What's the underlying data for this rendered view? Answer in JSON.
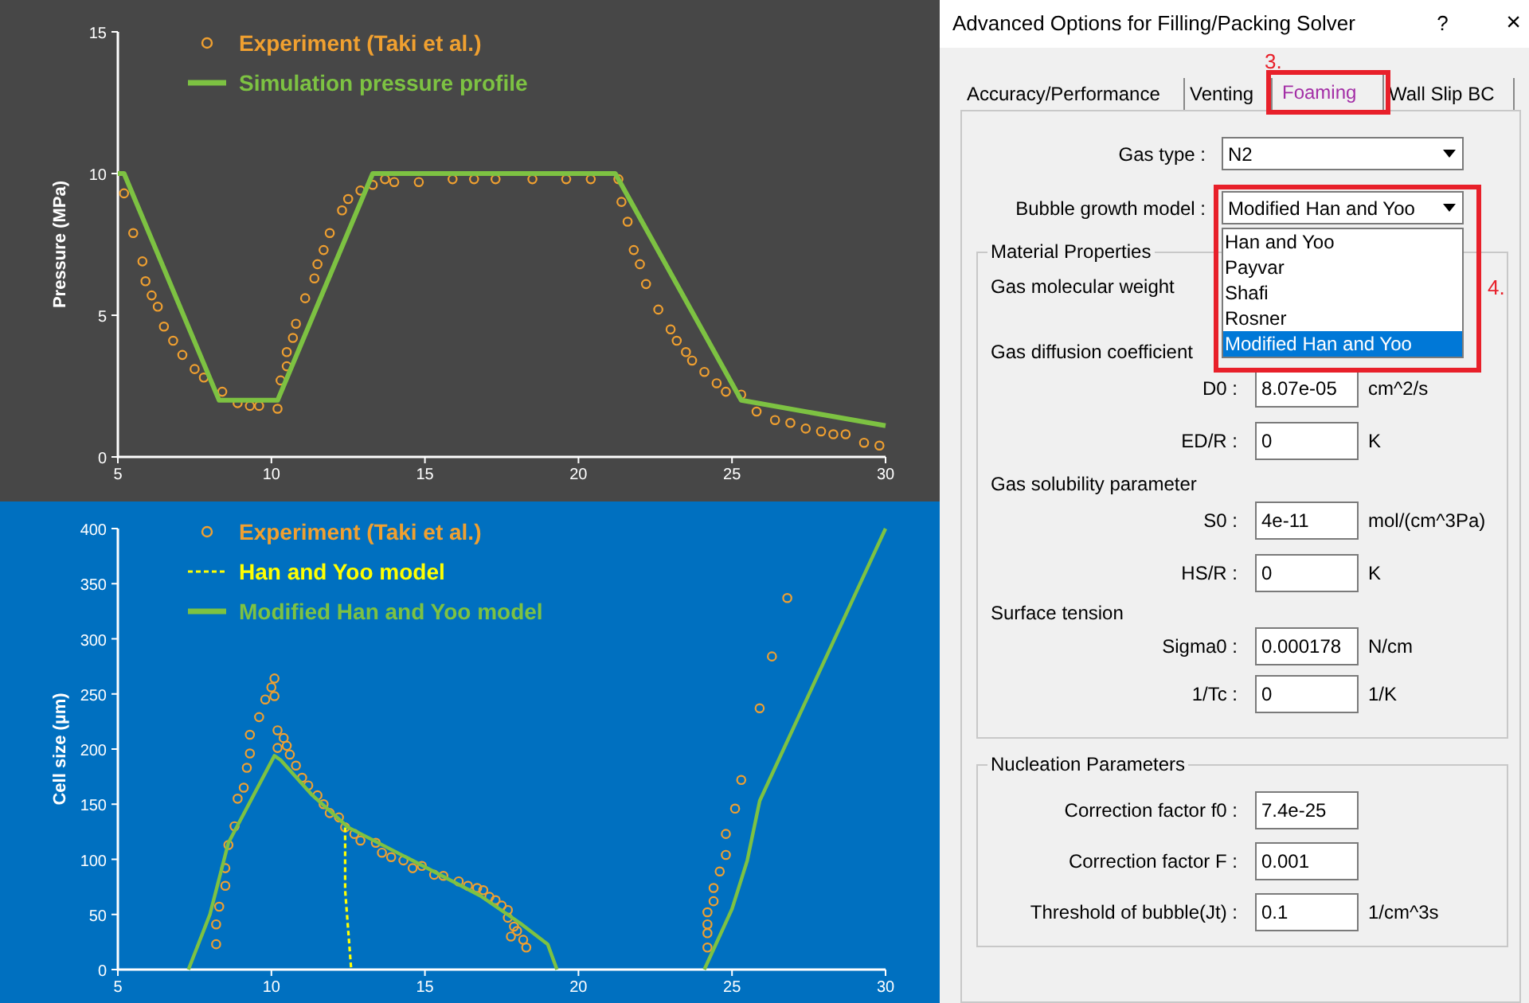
{
  "pressure_chart": {
    "chart_data": {
      "type": "scatter",
      "legend": true,
      "ylabel": "Pressure (MPa)",
      "xlim": [
        5,
        30
      ],
      "ylim": [
        0,
        15
      ],
      "xticks": [
        5,
        10,
        15,
        20,
        25,
        30
      ],
      "yticks": [
        0,
        5,
        10,
        15
      ],
      "series": [
        {
          "name": "Experiment (Taki et al.)",
          "type": "scatter",
          "color": "#f0a030",
          "x": [
            5.2,
            5.5,
            5.8,
            5.9,
            6.1,
            6.3,
            6.5,
            6.8,
            7.1,
            7.5,
            7.8,
            8.4,
            8.9,
            9.3,
            9.6,
            10.2,
            10.3,
            10.5,
            10.5,
            10.7,
            10.8,
            11.1,
            11.4,
            11.5,
            11.7,
            11.9,
            12.3,
            12.5,
            12.9,
            13.3,
            13.7,
            14.0,
            14.8,
            15.9,
            16.6,
            17.3,
            18.5,
            19.6,
            20.4,
            21.3,
            21.4,
            21.6,
            21.8,
            22.0,
            22.2,
            22.6,
            23.0,
            23.2,
            23.5,
            23.7,
            24.1,
            24.5,
            24.8,
            25.3,
            25.8,
            26.4,
            26.9,
            27.4,
            27.9,
            28.3,
            28.7,
            29.3,
            29.8
          ],
          "values": [
            9.3,
            7.9,
            6.9,
            6.2,
            5.7,
            5.3,
            4.6,
            4.1,
            3.6,
            3.1,
            2.8,
            2.3,
            1.9,
            1.8,
            1.8,
            1.7,
            2.7,
            3.2,
            3.7,
            4.2,
            4.7,
            5.6,
            6.3,
            6.8,
            7.3,
            7.9,
            8.7,
            9.1,
            9.4,
            9.6,
            9.8,
            9.7,
            9.7,
            9.8,
            9.8,
            9.8,
            9.8,
            9.8,
            9.8,
            9.8,
            9.0,
            8.3,
            7.3,
            6.8,
            6.1,
            5.2,
            4.5,
            4.1,
            3.7,
            3.4,
            3.0,
            2.6,
            2.3,
            2.2,
            1.6,
            1.3,
            1.2,
            1.0,
            0.9,
            0.8,
            0.8,
            0.5,
            0.4
          ]
        },
        {
          "name": "Simulation pressure profile",
          "type": "line",
          "color": "#7dc242",
          "x": [
            5.0,
            5.2,
            8.3,
            10.2,
            13.3,
            21.2,
            25.3,
            30.0
          ],
          "values": [
            10.0,
            10.0,
            2.0,
            2.0,
            10.0,
            10.0,
            2.0,
            1.1
          ]
        }
      ]
    }
  },
  "cell_size_chart": {
    "chart_data": {
      "type": "scatter",
      "legend": true,
      "ylabel": "Cell size (µm)",
      "xlim": [
        5,
        30
      ],
      "ylim": [
        0,
        400
      ],
      "xticks": [
        5,
        10,
        15,
        20,
        25,
        30
      ],
      "yticks": [
        0,
        50,
        100,
        150,
        200,
        250,
        300,
        350,
        400
      ],
      "series": [
        {
          "name": "Experiment (Taki et al.)",
          "type": "scatter",
          "color": "#f0a030",
          "x": [
            8.2,
            8.2,
            8.3,
            8.5,
            8.5,
            8.6,
            8.8,
            8.9,
            9.1,
            9.2,
            9.3,
            9.3,
            9.6,
            9.8,
            10.0,
            10.1,
            10.1,
            10.2,
            10.2,
            10.4,
            10.5,
            10.6,
            10.8,
            11.0,
            11.2,
            11.5,
            11.7,
            11.9,
            12.2,
            12.4,
            12.7,
            12.9,
            13.4,
            13.6,
            13.9,
            14.3,
            14.6,
            14.9,
            15.3,
            15.6,
            16.1,
            16.4,
            16.7,
            16.9,
            17.1,
            17.3,
            17.5,
            17.7,
            17.7,
            17.9,
            17.8,
            18.0,
            18.2,
            18.3,
            24.2,
            24.2,
            24.2,
            24.2,
            24.4,
            24.4,
            24.6,
            24.8,
            24.8,
            25.1,
            25.3,
            25.9,
            26.3,
            26.8
          ],
          "values": [
            23,
            41,
            57,
            76,
            92,
            113,
            130,
            155,
            165,
            183,
            196,
            213,
            229,
            245,
            256,
            264,
            248,
            217,
            201,
            210,
            203,
            195,
            185,
            174,
            167,
            158,
            150,
            142,
            138,
            129,
            123,
            117,
            115,
            106,
            102,
            99,
            92,
            94,
            86,
            85,
            80,
            76,
            74,
            72,
            66,
            63,
            58,
            54,
            47,
            39,
            30,
            35,
            27,
            20,
            20,
            33,
            41,
            52,
            62,
            74,
            89,
            104,
            123,
            146,
            172,
            237,
            284,
            337
          ]
        },
        {
          "name": "Han and Yoo model",
          "type": "line",
          "line_style": "dashed",
          "color": "#ffff00",
          "x": [
            12.4,
            12.4,
            12.6
          ],
          "values": [
            129,
            72,
            0
          ]
        },
        {
          "name": "Modified Han and Yoo model",
          "type": "line",
          "color": "#7dc242",
          "x": [
            7.3,
            8.0,
            8.6,
            10.1,
            10.3,
            11.3,
            12.5,
            14.8,
            16.8,
            18.1,
            19.0,
            19.3,
            null,
            24.1,
            25.0,
            25.5,
            25.9,
            30.0
          ],
          "values": [
            0,
            50,
            115,
            194,
            190,
            159,
            129,
            96,
            67,
            42,
            23,
            0,
            null,
            0,
            55,
            99,
            153,
            400
          ]
        }
      ]
    }
  },
  "dialog": {
    "title": "Advanced Options for Filling/Packing Solver",
    "help_button": "?",
    "close_button": "×",
    "tabs": [
      {
        "label": "Accuracy/Performance",
        "selected": false
      },
      {
        "label": "Venting",
        "selected": false
      },
      {
        "label": "Foaming",
        "selected": true
      },
      {
        "label": "Wall Slip BC",
        "selected": false
      }
    ],
    "gas_type": {
      "label": "Gas type :",
      "value": "N2"
    },
    "bubble_growth_model": {
      "label": "Bubble growth model :",
      "value": "Modified Han and Yoo",
      "expanded": true,
      "options": [
        {
          "label": "Han and Yoo",
          "selected": false
        },
        {
          "label": "Payvar",
          "selected": false
        },
        {
          "label": "Shafi",
          "selected": false
        },
        {
          "label": "Rosner",
          "selected": false
        },
        {
          "label": "Modified Han and Yoo",
          "selected": true
        }
      ]
    },
    "material_properties": {
      "title": "Material Properties",
      "sections": [
        {
          "heading": "Gas molecular weight"
        },
        {
          "heading": "Gas diffusion coefficient",
          "fields": [
            {
              "label": "D0 :",
              "value": "8.07e-05",
              "unit": "cm^2/s"
            },
            {
              "label": "ED/R :",
              "value": "0",
              "unit": "K"
            }
          ]
        },
        {
          "heading": "Gas solubility parameter",
          "fields": [
            {
              "label": "S0 :",
              "value": "4e-11",
              "unit": "mol/(cm^3Pa)"
            },
            {
              "label": "HS/R :",
              "value": "0",
              "unit": "K"
            }
          ]
        },
        {
          "heading": "Surface tension",
          "fields": [
            {
              "label": "Sigma0 :",
              "value": "0.000178",
              "unit": "N/cm"
            },
            {
              "label": "1/Tc :",
              "value": "0",
              "unit": "1/K"
            }
          ]
        }
      ]
    },
    "nucleation_parameters": {
      "title": "Nucleation Parameters",
      "fields": [
        {
          "label": "Correction factor f0 :",
          "value": "7.4e-25"
        },
        {
          "label": "Correction factor F :",
          "value": "0.001"
        },
        {
          "label": "Threshold of bubble(Jt) :",
          "value": "0.1",
          "unit": "1/cm^3s"
        }
      ]
    },
    "callouts": [
      {
        "label": "3."
      },
      {
        "label": "4."
      }
    ]
  }
}
